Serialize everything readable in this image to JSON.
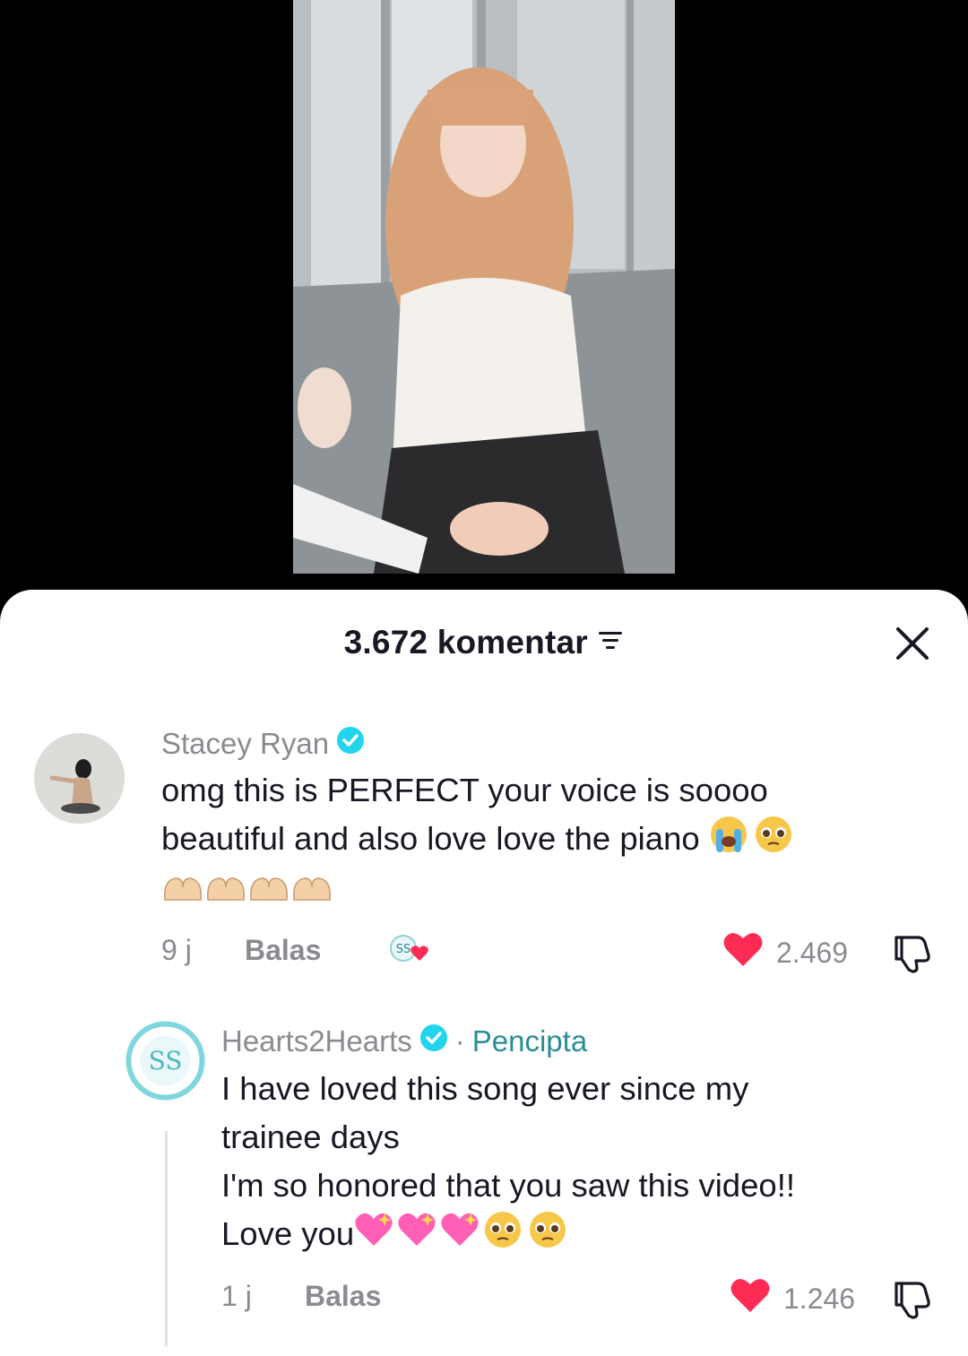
{
  "header": {
    "comment_count": "3.672 komentar",
    "icons": {
      "filter": "filter-icon",
      "close": "close-icon"
    }
  },
  "comments": [
    {
      "username": "Stacey Ryan",
      "verified": true,
      "text_line1": "omg this is PERFECT your voice is soooo",
      "text_line2": "beautiful and also love love the piano",
      "emoji_after_text": [
        "loudly-crying-face",
        "pleading-face"
      ],
      "emoji_line3": [
        "heart-hands",
        "heart-hands",
        "heart-hands",
        "heart-hands"
      ],
      "time": "9 j",
      "reply_label": "Balas",
      "creator_liked": true,
      "likes": "2.469"
    },
    {
      "username": "Hearts2Hearts",
      "verified": true,
      "creator_separator": "·",
      "creator_label": "Pencipta",
      "text_line1": "I have loved this song ever since my",
      "text_line2": "trainee days",
      "text_line3": "I'm so honored that you saw this video!!",
      "text_line4": "Love you",
      "emoji_after_text": [
        "sparkling-heart",
        "sparkling-heart",
        "sparkling-heart",
        "pleading-face",
        "pleading-face"
      ],
      "time": "1 j",
      "reply_label": "Balas",
      "likes": "1.246"
    }
  ],
  "colors": {
    "background_video": "#000000",
    "sheet": "#ffffff",
    "text_primary": "#161823",
    "text_secondary": "#8a8b91",
    "heart_red": "#fe2c55",
    "verified_blue": "#20d5ec",
    "creator_teal": "#2a8d94"
  }
}
